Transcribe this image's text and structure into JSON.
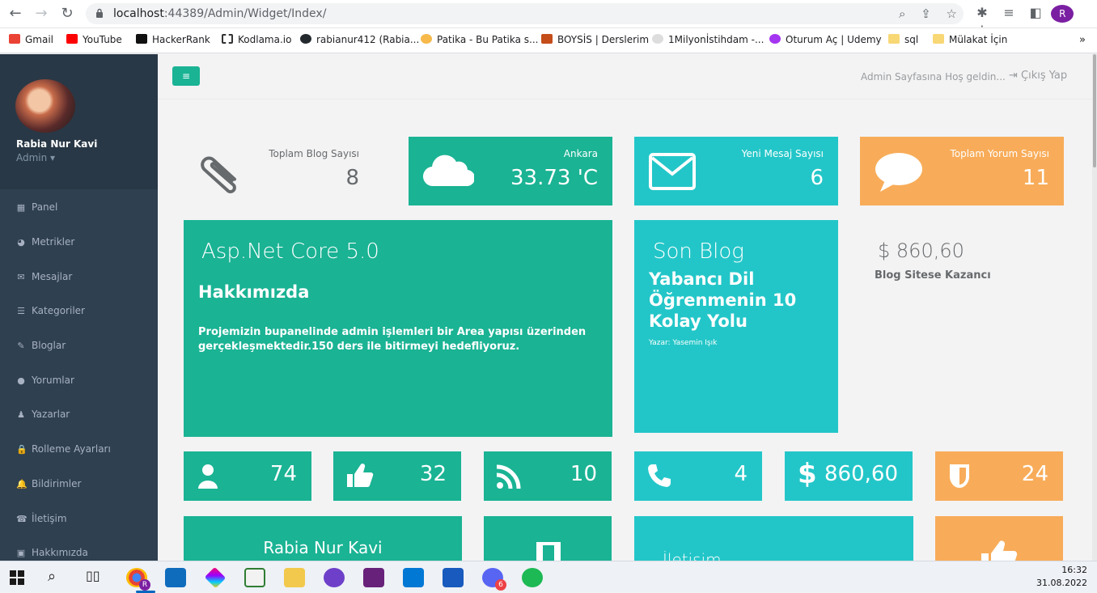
{
  "browser": {
    "url_host": "localhost",
    "url_path": ":44389/Admin/Widget/Index/",
    "profile_initial": "R"
  },
  "bookmarks": [
    {
      "label": "Gmail",
      "color": "#ea4335"
    },
    {
      "label": "YouTube",
      "color": "#ff0000"
    },
    {
      "label": "HackerRank",
      "color": "#111111"
    },
    {
      "label": "Kodlama.io",
      "color": "#333333"
    },
    {
      "label": "rabianur412 (Rabia...",
      "color": "#24292e"
    },
    {
      "label": "Patika - Bu Patika s...",
      "color": "#f6b94a"
    },
    {
      "label": "BOYSİS | Derslerim",
      "color": "#c44d1a"
    },
    {
      "label": "1Milyonİstihdam -...",
      "color": "#bbbbbb"
    },
    {
      "label": "Oturum Aç | Udemy",
      "color": "#a435f0"
    },
    {
      "label": "sql",
      "color": "#f8d775"
    },
    {
      "label": "Mülakat İçin",
      "color": "#f8d775"
    }
  ],
  "sidebar": {
    "profile_name": "Rabia Nur Kavi",
    "profile_role": "Admin ▾",
    "items": [
      {
        "label": "Panel",
        "icon": "▦"
      },
      {
        "label": "Metrikler",
        "icon": "◕"
      },
      {
        "label": "Mesajlar",
        "icon": "✉"
      },
      {
        "label": "Kategoriler",
        "icon": "☰"
      },
      {
        "label": "Bloglar",
        "icon": "✎"
      },
      {
        "label": "Yorumlar",
        "icon": "●"
      },
      {
        "label": "Yazarlar",
        "icon": "♟"
      },
      {
        "label": "Rolleme Ayarları",
        "icon": "🔒"
      },
      {
        "label": "Bildirimler",
        "icon": "🔔"
      },
      {
        "label": "İletişim",
        "icon": "☎"
      },
      {
        "label": "Hakkımızda",
        "icon": "▣"
      }
    ]
  },
  "topbar": {
    "welcome": "Admin Sayfasına Hoş geldin...",
    "logout": "Çıkış Yap"
  },
  "widgets": {
    "blog_count": {
      "title": "Toplam Blog Sayısı",
      "value": "8"
    },
    "weather": {
      "title": "Ankara",
      "value": "33.73 'C"
    },
    "messages": {
      "title": "Yeni Mesaj Sayısı",
      "value": "6"
    },
    "comments": {
      "title": "Toplam Yorum Sayısı",
      "value": "11"
    },
    "about": {
      "heading": "Asp.Net Core 5.0",
      "subheading": "Hakkımızda",
      "text": "Projemizin bupanelinde admin işlemleri bir Area yapısı üzerinden gerçekleşmektedir.150 ders ile bitirmeyi hedefliyoruz."
    },
    "last_blog": {
      "heading": "Son Blog",
      "title": "Yabancı Dil Öğrenmenin 10 Kolay Yolu",
      "author": "Yazar: Yasemin Işık"
    },
    "earnings": {
      "value": "$ 860,60",
      "label": "Blog Sitese Kazancı"
    },
    "small": [
      {
        "icon": "user-icon",
        "value": "74"
      },
      {
        "icon": "thumbs-up-icon",
        "value": "32"
      },
      {
        "icon": "rss-icon",
        "value": "10"
      },
      {
        "icon": "phone-icon",
        "value": "4"
      },
      {
        "icon": "dollar-icon",
        "value": "860,60"
      },
      {
        "icon": "shield-icon",
        "value": "24"
      }
    ],
    "bottom": {
      "name": "Rabia Nur Kavi",
      "contact": "İletişim"
    }
  },
  "taskbar": {
    "time": "16:32",
    "date": "31.08.2022",
    "chrome_badge": "R",
    "discord_badge": "6"
  },
  "colors": {
    "green": "#1ab394",
    "cyan": "#23c6c8",
    "orange": "#f8ac59",
    "sidebar": "#2f4050"
  }
}
